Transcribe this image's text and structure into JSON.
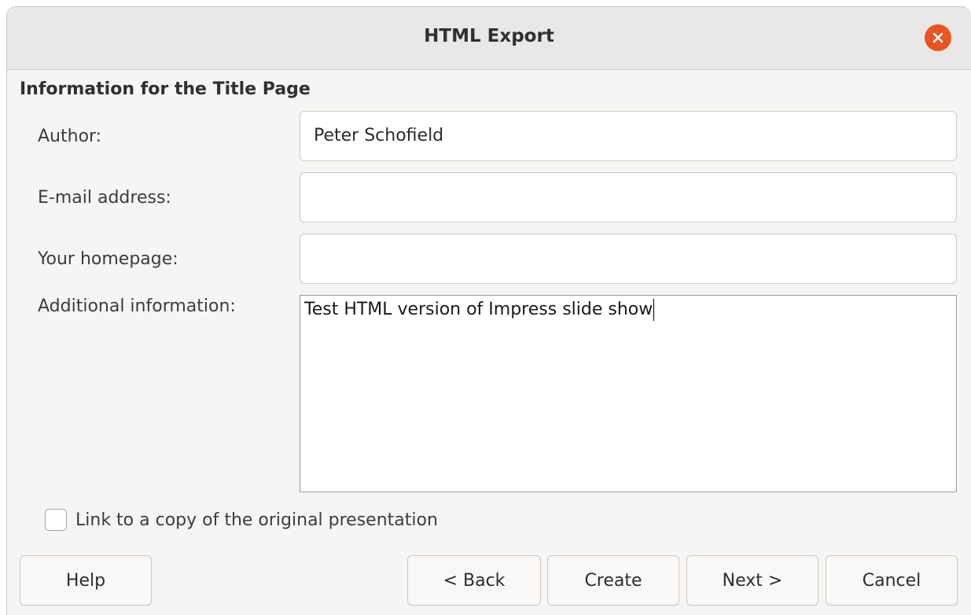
{
  "window": {
    "title": "HTML Export",
    "accent_color": "#e95420"
  },
  "section": {
    "heading": "Information for the Title Page"
  },
  "fields": {
    "author": {
      "label": "Author:",
      "value": "Peter Schofield"
    },
    "email": {
      "label": "E-mail address:",
      "value": ""
    },
    "homepage": {
      "label": "Your homepage:",
      "value": ""
    },
    "additional": {
      "label": "Additional information:",
      "value": "Test HTML version of Impress slide show"
    }
  },
  "checkbox": {
    "label": "Link to a copy of the original presentation",
    "checked": false
  },
  "buttons": {
    "help": "Help",
    "back": "< Back",
    "create": "Create",
    "next": "Next >",
    "cancel": "Cancel"
  },
  "icons": {
    "close": "close-icon"
  }
}
